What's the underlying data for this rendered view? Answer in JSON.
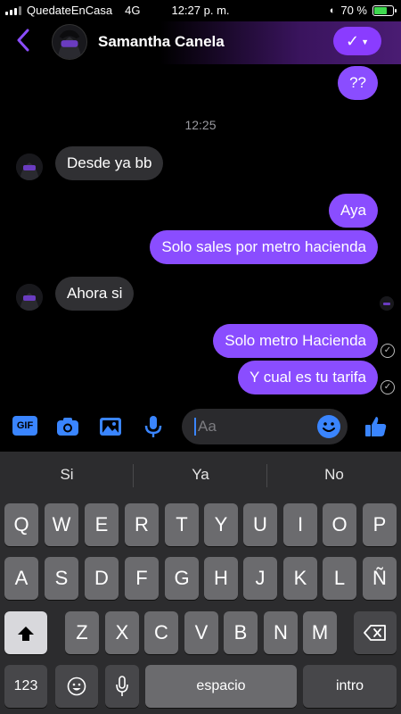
{
  "status_bar": {
    "carrier": "QuedateEnCasa",
    "network": "4G",
    "time": "12:27 p. m.",
    "battery": "70 %"
  },
  "header": {
    "contact_name": "Samantha Canela",
    "back_icon": "chevron-left-icon",
    "action_icon": "checkmark-dropdown-icon"
  },
  "conversation": {
    "timestamp": "12:25",
    "messages": [
      {
        "from": "me",
        "text": "??"
      },
      {
        "from": "contact",
        "text": "Desde ya bb"
      },
      {
        "from": "me",
        "text": "Aya"
      },
      {
        "from": "me",
        "text": "Solo sales por metro hacienda"
      },
      {
        "from": "contact",
        "text": "Ahora si"
      },
      {
        "from": "me",
        "text": "Solo metro Hacienda"
      },
      {
        "from": "me",
        "text": "Y cual es tu tarifa"
      }
    ]
  },
  "composer": {
    "gif_label": "GIF",
    "placeholder": "Aa",
    "accent": "#3a85ff"
  },
  "keyboard": {
    "suggestions": [
      "Si",
      "Ya",
      "No"
    ],
    "row1": [
      "Q",
      "W",
      "E",
      "R",
      "T",
      "Y",
      "U",
      "I",
      "O",
      "P"
    ],
    "row2": [
      "A",
      "S",
      "D",
      "F",
      "G",
      "H",
      "J",
      "K",
      "L",
      "Ñ"
    ],
    "row3": [
      "Z",
      "X",
      "C",
      "V",
      "B",
      "N",
      "M"
    ],
    "numbers_key": "123",
    "space_key": "espacio",
    "return_key": "intro"
  },
  "colors": {
    "outgoing_bubble": "#8a4dff",
    "incoming_bubble": "#303033",
    "header_button": "#8a3cff"
  }
}
